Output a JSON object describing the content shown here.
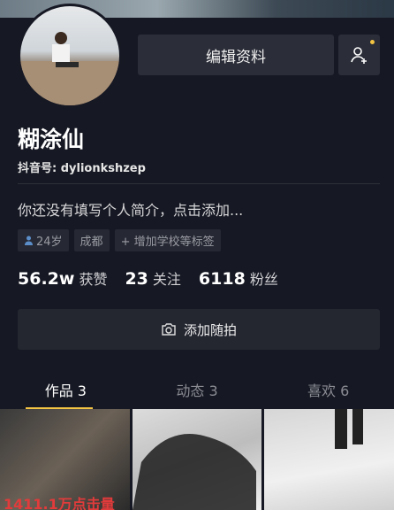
{
  "profile": {
    "name": "糊涂仙",
    "douyin_id": "抖音号: dylionkshzep",
    "bio": "你还没有填写个人简介，点击添加..."
  },
  "actions": {
    "edit_label": "编辑资料",
    "post_label": "添加随拍"
  },
  "tags": {
    "age": "24岁",
    "city": "成都",
    "add_school": "+ 增加学校等标签"
  },
  "stats": {
    "likes_value": "56.2w",
    "likes_label": "获赞",
    "following_value": "23",
    "following_label": "关注",
    "followers_value": "6118",
    "followers_label": "粉丝"
  },
  "tabs": {
    "works": "作品 3",
    "activity": "动态 3",
    "favorites": "喜欢 6"
  },
  "videos": {
    "first_caption": "1411.1万点击量"
  },
  "colors": {
    "background": "#161823",
    "accent": "#f4c542"
  }
}
